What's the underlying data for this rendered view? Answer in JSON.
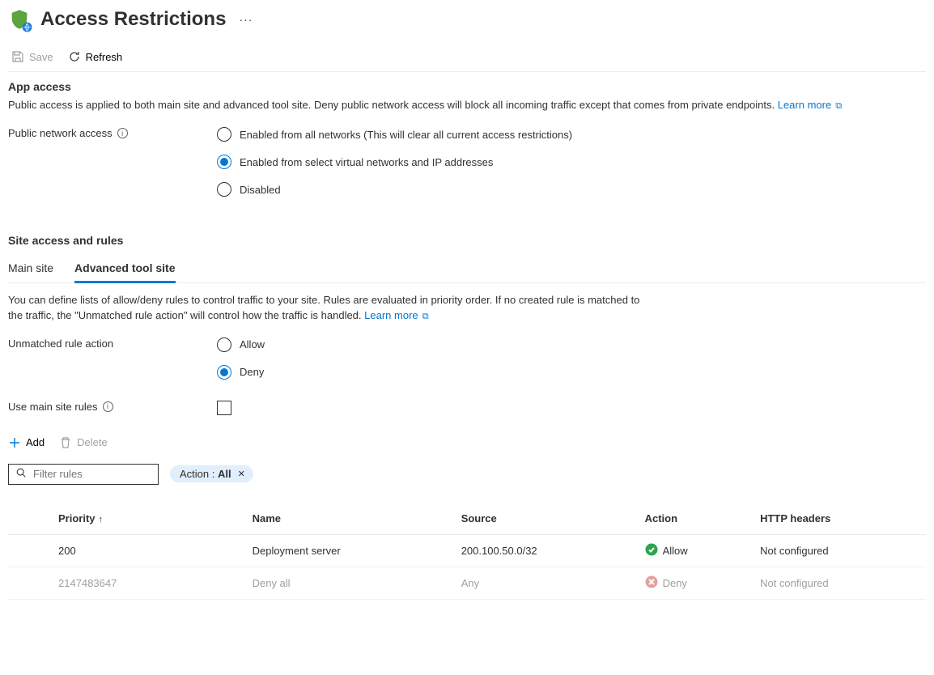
{
  "header": {
    "title": "Access Restrictions"
  },
  "toolbar": {
    "save_label": "Save",
    "refresh_label": "Refresh"
  },
  "app_access": {
    "title": "App access",
    "desc": "Public access is applied to both main site and advanced tool site. Deny public network access will block all incoming traffic except that comes from private endpoints.",
    "learn_more": "Learn more",
    "field_label": "Public network access",
    "options": {
      "all": "Enabled from all networks (This will clear all current access restrictions)",
      "select": "Enabled from select virtual networks and IP addresses",
      "disabled": "Disabled"
    },
    "selected": "select"
  },
  "site_rules": {
    "title": "Site access and rules",
    "tabs": {
      "main": "Main site",
      "advanced": "Advanced tool site"
    },
    "active_tab": "advanced",
    "desc": "You can define lists of allow/deny rules to control traffic to your site. Rules are evaluated in priority order. If no created rule is matched to the traffic, the \"Unmatched rule action\" will control how the traffic is handled.",
    "learn_more": "Learn more",
    "unmatched_label": "Unmatched rule action",
    "unmatched_options": {
      "allow": "Allow",
      "deny": "Deny"
    },
    "unmatched_selected": "deny",
    "use_main_label": "Use main site rules"
  },
  "rules_toolbar": {
    "add_label": "Add",
    "delete_label": "Delete"
  },
  "filter": {
    "placeholder": "Filter rules",
    "chip_label": "Action : ",
    "chip_value": "All"
  },
  "table": {
    "headers": {
      "priority": "Priority",
      "name": "Name",
      "source": "Source",
      "action": "Action",
      "http": "HTTP headers"
    },
    "rows": [
      {
        "priority": "200",
        "name": "Deployment server",
        "source": "200.100.50.0/32",
        "action": "Allow",
        "action_type": "allow",
        "http": "Not configured",
        "muted": false
      },
      {
        "priority": "2147483647",
        "name": "Deny all",
        "source": "Any",
        "action": "Deny",
        "action_type": "deny",
        "http": "Not configured",
        "muted": true
      }
    ]
  }
}
